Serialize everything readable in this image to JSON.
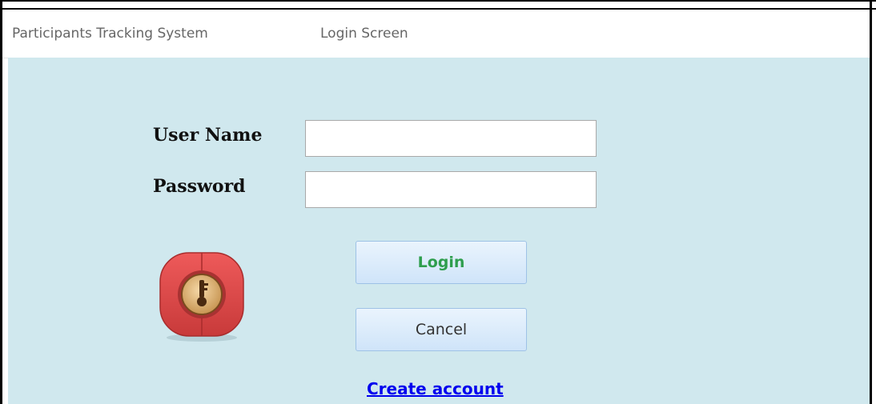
{
  "header": {
    "app_title": "Participants Tracking System",
    "screen_title": "Login Screen"
  },
  "form": {
    "username_label": "User Name",
    "username_value": "",
    "password_label": "Password",
    "password_value": ""
  },
  "buttons": {
    "login_label": "Login",
    "cancel_label": "Cancel"
  },
  "links": {
    "create_account": "Create account"
  },
  "icons": {
    "badge": "key-lock-icon"
  },
  "colors": {
    "panel_bg": "#d0e8ee",
    "login_text": "#2e9e4d",
    "link": "#0000ee",
    "badge_red": "#d94545"
  }
}
